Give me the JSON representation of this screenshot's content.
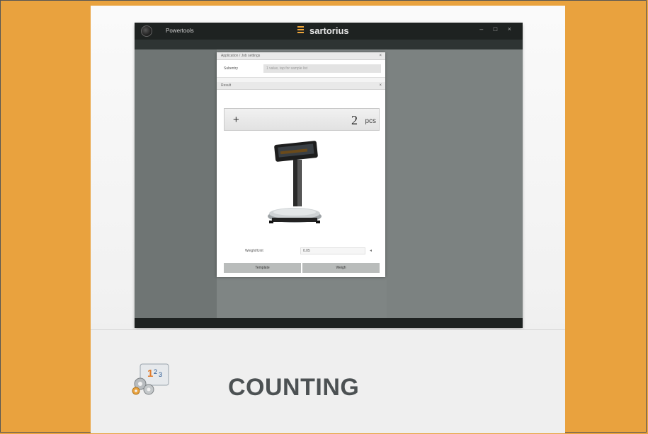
{
  "titlebar": {
    "app_name": "Powertools",
    "brand": "sartorius",
    "window_controls": "– □ ×"
  },
  "dialog": {
    "section1_title": "Application / Job settings",
    "sub_label": "Subentry",
    "sub_value": "1 value, tap for sample list",
    "section2_title": "Result",
    "display": {
      "sign": "+",
      "value": "2",
      "unit": "pcs"
    },
    "ref_label": "Weight/Unit",
    "ref_value": "0.05",
    "buttons": [
      "Template",
      "Weigh"
    ]
  },
  "feature": {
    "icon": "counting-icon",
    "title": "COUNTING"
  },
  "colors": {
    "background": "#e9a23e",
    "accent": "#f0a63a",
    "title_text": "#4c5153"
  }
}
